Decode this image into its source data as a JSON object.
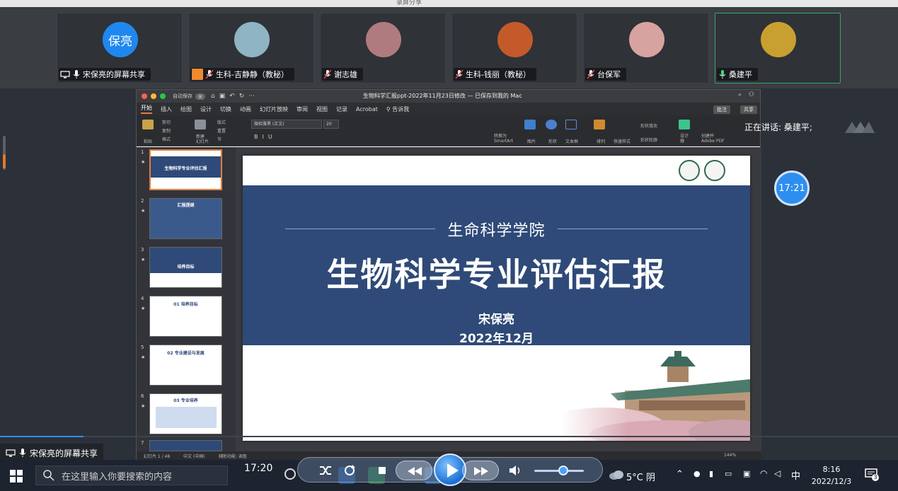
{
  "window_title": "录屏分享",
  "participants": [
    {
      "name": "宋保亮的屏幕共享",
      "avatar_text": "保亮",
      "avatar_color": "#1e88f0",
      "icon": "screen-share-icon",
      "mic": "mic-on"
    },
    {
      "name": "生科-吉静静（教秘）",
      "avatar_color": "#8fb4c4",
      "icon": "host-badge-icon",
      "mic": "mic-muted"
    },
    {
      "name": "谢志雄",
      "avatar_color": "#b07b7e",
      "mic": "mic-muted"
    },
    {
      "name": "生科-钱丽（教秘）",
      "avatar_color": "#c45a2a",
      "mic": "mic-muted"
    },
    {
      "name": "台保军",
      "avatar_color": "#d7a3a0",
      "mic": "mic-muted"
    },
    {
      "name": "桑建平",
      "avatar_color": "#c8a030",
      "mic": "mic-on-green"
    }
  ],
  "ppt": {
    "autosave": "自动保存",
    "autosave_state": "关",
    "document_title": "生物科学汇报ppt-2022年11月23日修改 — 已保存到我的 Mac",
    "tabs": [
      "开始",
      "插入",
      "绘图",
      "设计",
      "切换",
      "动画",
      "幻灯片放映",
      "审阅",
      "视图",
      "记录",
      "Acrobat",
      "告诉我"
    ],
    "comment_btn": "批注",
    "share_btn": "共享",
    "font_name": "微软雅黑 (正文)",
    "font_size": "20",
    "ribbon_labels": {
      "paste": "粘贴",
      "cut": "剪切",
      "copy": "复制",
      "format": "格式",
      "new_slide": "新建\n幻灯片",
      "layout": "版式",
      "reset": "重置",
      "section": "节",
      "smartart": "转换为\nSmartArt",
      "picture": "图片",
      "shape": "形状",
      "textbox": "文本框",
      "arrange": "排列",
      "quick_styles": "快速样式",
      "shape_fill": "形状填充",
      "shape_outline": "形状轮廓",
      "design": "设计\n器",
      "create_pdf": "创建并\nAdobe PDF"
    },
    "thumbnails": [
      {
        "num": "1",
        "title": "生物科学专业评估汇报"
      },
      {
        "num": "2",
        "title": "汇报提纲"
      },
      {
        "num": "3",
        "title": "培养目标"
      },
      {
        "num": "4",
        "title": "01 培养目标"
      },
      {
        "num": "5",
        "title": "02 专业建设与发展"
      },
      {
        "num": "6",
        "title": "03 专业培养"
      },
      {
        "num": "7",
        "title": ""
      }
    ],
    "slide": {
      "subtitle": "生命科学学院",
      "title": "生物科学专业评估汇报",
      "author": "宋保亮",
      "date": "2022年12月"
    },
    "status": {
      "slide_count": "幻灯片 1 / 48",
      "language": "中文 (中国)",
      "accessibility": "辅助功能: 调查",
      "zoom": "144%"
    }
  },
  "speaking": "正在讲话: 桑建平;",
  "timer": "17:21",
  "screen_share_label": "宋保亮的屏幕共享",
  "taskbar": {
    "search_placeholder": "在这里输入你要搜索的内容",
    "weather": "5°C 阴",
    "ime": "中",
    "time": "8:16",
    "date": "2022/12/3",
    "notification_count": "3"
  },
  "player": {
    "current_time": "17:20"
  },
  "colors": {
    "slide_band": "#2f4a78",
    "accent_orange": "#e27d3b",
    "active_speaker": "#3aa56a",
    "timer_blue": "#2e8ef0"
  }
}
